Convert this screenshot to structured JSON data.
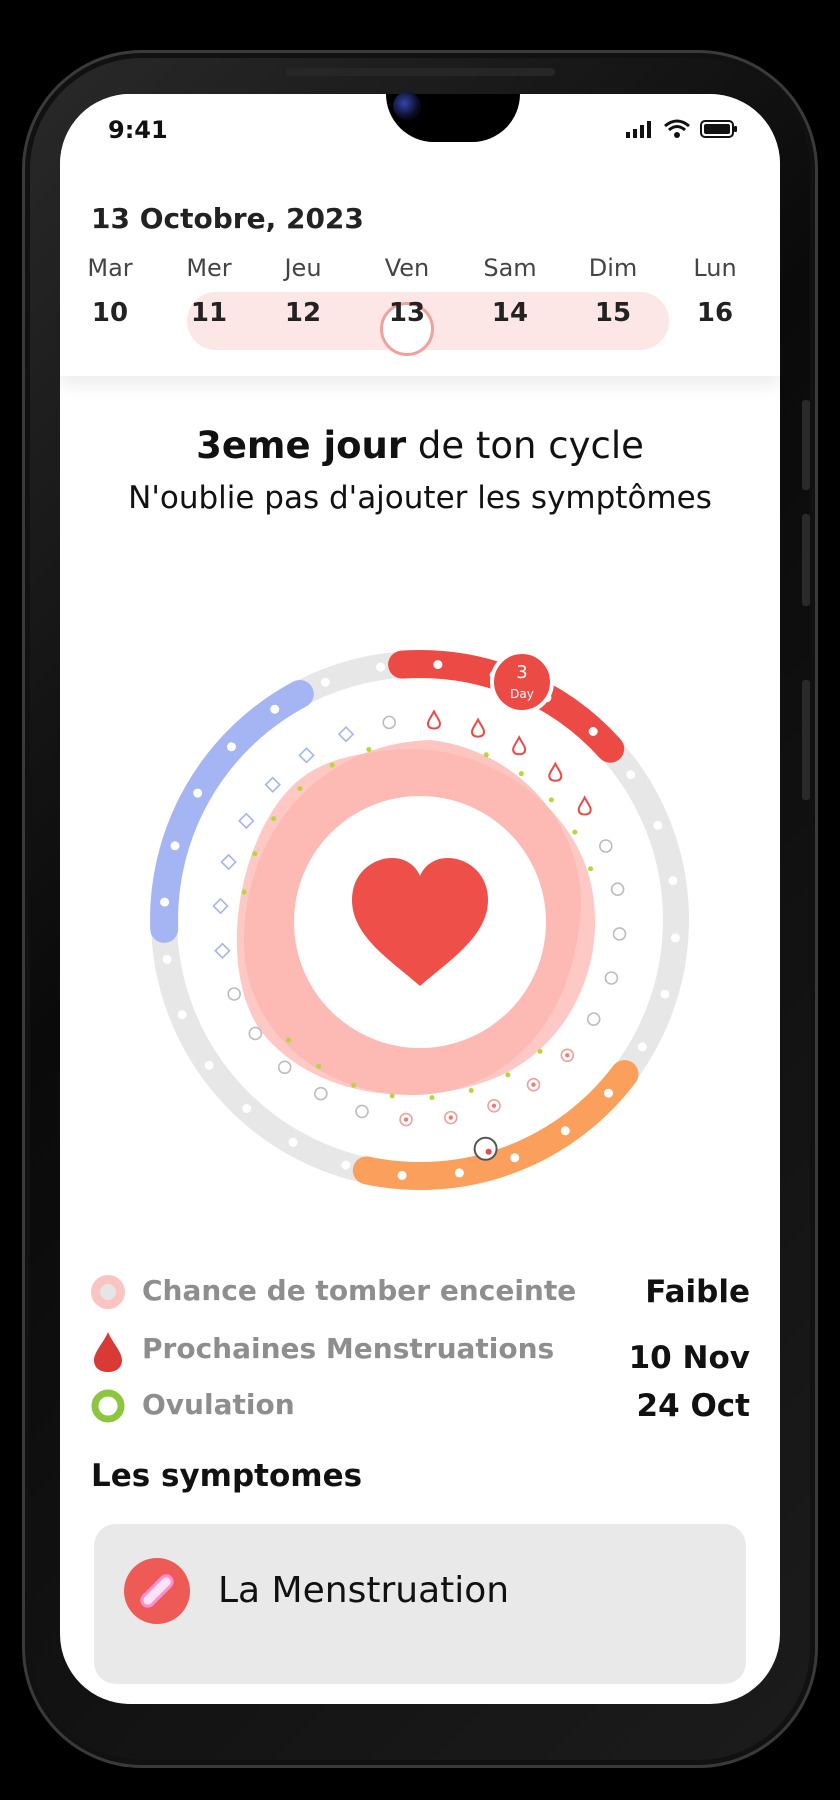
{
  "status_bar": {
    "time": "9:41"
  },
  "header": {
    "date": "13 Octobre, 2023",
    "week": [
      {
        "name": "Mar",
        "num": "10"
      },
      {
        "name": "Mer",
        "num": "11"
      },
      {
        "name": "Jeu",
        "num": "12"
      },
      {
        "name": "Ven",
        "num": "13"
      },
      {
        "name": "Sam",
        "num": "14"
      },
      {
        "name": "Dim",
        "num": "15"
      },
      {
        "name": "Lun",
        "num": "16"
      }
    ],
    "selected_day": "13"
  },
  "cycle": {
    "headline_bold": "3eme jour",
    "headline_rest": " de ton cycle",
    "subtitle": "N'oublie pas d'ajouter les symptômes",
    "current_day": "3",
    "current_day_unit": "Day"
  },
  "legend": [
    {
      "icon": "fertility-dot-icon",
      "label": "Chance de tomber enceinte",
      "value": "Faible"
    },
    {
      "icon": "blood-drop-icon",
      "label": "Prochaines Menstruations",
      "value": "10 Nov"
    },
    {
      "icon": "ovulation-ring-icon",
      "label": "Ovulation",
      "value": "24 Oct"
    }
  ],
  "symptoms": {
    "title": "Les symptomes",
    "items": [
      {
        "icon": "pad-icon",
        "label": "La Menstruation"
      }
    ]
  },
  "colors": {
    "period": "#ec4a44",
    "follicular": "#a5b4f3",
    "fertile": "#fb9f5d",
    "track": "#e7e7e7",
    "blob": "#fdb6b0",
    "heart": "#ee5049",
    "ovulation_green": "#8cc63f"
  }
}
